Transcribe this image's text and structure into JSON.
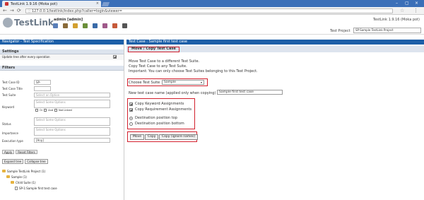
{
  "browser": {
    "tab_title": "TestLink 1.9.16 (Moka pot)",
    "url": "127.0.0.1/testlink/index.php?caller=login&viewer=",
    "close": "×",
    "back": "←",
    "forward": "→",
    "reload": "⟳",
    "star": "☆",
    "menu": "⋮",
    "win_min": "–",
    "win_max": "▢",
    "win_close": "×"
  },
  "header": {
    "logo": "TestLink",
    "user": "admin [admin]",
    "version": "TestLink 1.9.16 (Moka pot)",
    "project_label": "Test Project",
    "project_value": "SP:Sample TestLink Project"
  },
  "left": {
    "navigator_title": "Navigator - Test Specification",
    "settings_heading": "Settings",
    "setting_update_tree": "Update tree after every operation",
    "filters_heading": "Filters",
    "filters": [
      {
        "label": "Test Case ID",
        "value": "SP-"
      },
      {
        "label": "Test Case Title",
        "value": ""
      },
      {
        "label": "Test Suite",
        "value": "Select an Option"
      },
      {
        "label": "Keyword",
        "value": "Select Some Options"
      },
      {
        "label": "Status",
        "value": "Select Some Options"
      },
      {
        "label": "Importance",
        "value": "Select Some Options"
      },
      {
        "label": "Execution type",
        "value": "[Any]"
      }
    ],
    "keyword_or": "Or",
    "keyword_and": "And",
    "keyword_not_linked": "Not Linked",
    "tab_apply": "Apply",
    "tab_reset": "Reset Filters",
    "btn_expand": "Expand tree",
    "btn_collapse": "Collapse tree",
    "tree": [
      "Sample TestLink Project (1)",
      "Sample (1)",
      "Child Suite (1)",
      "SP-1:Sample first test case"
    ]
  },
  "main": {
    "page_title": "Test Case : Sample first test case",
    "operation_title": "Move / Copy Test Case",
    "info_lines": [
      "Move Test Case to a different Test Suite.",
      "Copy Test Case to any Test Suite.",
      "Important: You can only choose Test Suites belonging to this Test Project."
    ],
    "choose_label": "Choose Test Suite",
    "choose_value": "Sample",
    "new_name_label": "New test case name (applied only when copying)",
    "new_name_value": "Sample first test case",
    "opt_copy_keywords": "Copy Keyword Assignments",
    "opt_copy_requirements": "Copy Requirement Assignments",
    "opt_dest_top": "Destination position top",
    "opt_dest_bottom": "Destination position bottom",
    "btn_move": "Move",
    "btn_copy": "Copy",
    "btn_copy_ignore": "Copy (ignore names)"
  }
}
